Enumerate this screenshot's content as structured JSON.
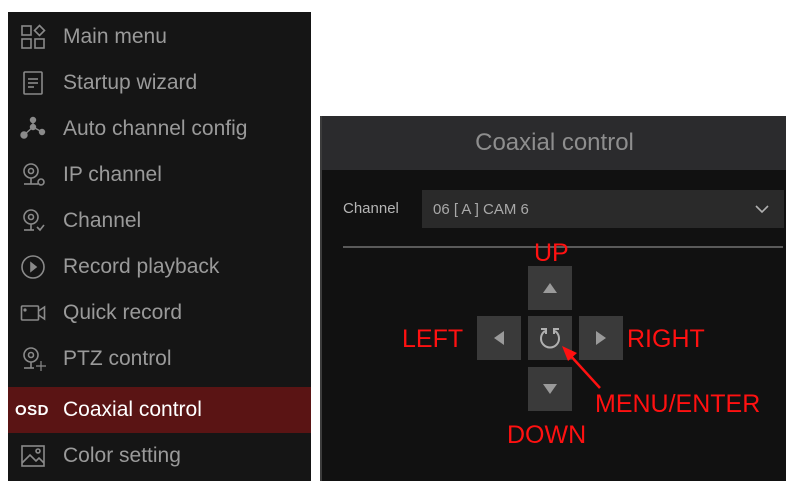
{
  "menu": {
    "items": [
      {
        "label": "Main menu",
        "icon": "grid-icon"
      },
      {
        "label": "Startup wizard",
        "icon": "document-icon"
      },
      {
        "label": "Auto channel config",
        "icon": "network-icon"
      },
      {
        "label": "IP channel",
        "icon": "ip-camera-icon"
      },
      {
        "label": "Channel",
        "icon": "camera-icon"
      },
      {
        "label": "Record playback",
        "icon": "play-circle-icon"
      },
      {
        "label": "Quick record",
        "icon": "video-camera-icon"
      },
      {
        "label": "PTZ control",
        "icon": "ptz-camera-icon"
      },
      {
        "label": "Coaxial control",
        "icon": "osd-icon",
        "icon_text": "OSD",
        "active": true
      },
      {
        "label": "Color setting",
        "icon": "image-icon"
      }
    ],
    "active_color": "#5a1414"
  },
  "panel": {
    "title": "Coaxial control",
    "channel_label": "Channel",
    "channel_value": "06 [ A ] CAM 6"
  },
  "annotations": {
    "up": "UP",
    "down": "DOWN",
    "left": "LEFT",
    "right": "RIGHT",
    "menu_enter": "MENU/ENTER",
    "color": "#ff1111"
  }
}
